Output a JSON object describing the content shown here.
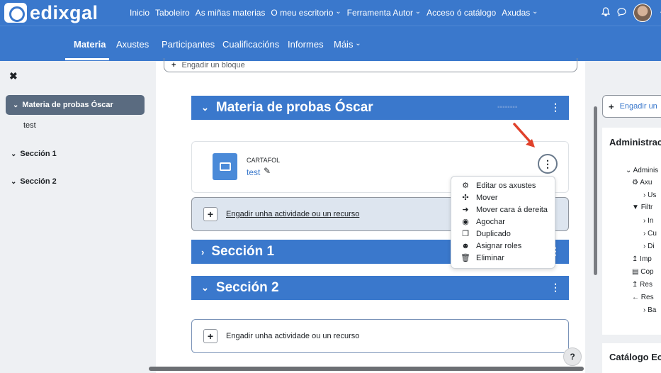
{
  "colors": {
    "brand": "#3a78cc",
    "accent_arrow": "#e0412b",
    "drawer_active": "#5a6b80"
  },
  "brand": {
    "logo_text": "edixgal"
  },
  "topnav": {
    "items": [
      {
        "label": "Inicio",
        "dropdown": false
      },
      {
        "label": "Taboleiro",
        "dropdown": false
      },
      {
        "label": "As miñas materias",
        "dropdown": false
      },
      {
        "label": "O meu escritorio",
        "dropdown": true
      },
      {
        "label": "Ferramenta Autor",
        "dropdown": true
      },
      {
        "label": "Acceso ó catálogo",
        "dropdown": false
      },
      {
        "label": "Axudas",
        "dropdown": true
      }
    ]
  },
  "subnav": {
    "tabs": [
      {
        "label": "Materia",
        "active": true
      },
      {
        "label": "Axustes"
      },
      {
        "label": "Participantes"
      },
      {
        "label": "Cualificacións"
      },
      {
        "label": "Informes"
      },
      {
        "label": "Máis",
        "dropdown": true
      }
    ]
  },
  "drawer": {
    "close_glyph": "✖",
    "items": [
      {
        "label": "Materia de probas Óscar",
        "active": true
      },
      {
        "label": "test",
        "sub": true
      },
      {
        "label": "Sección 1"
      },
      {
        "label": "Sección 2"
      }
    ]
  },
  "main": {
    "add_block_label": "Engadir un bloque",
    "sections": [
      {
        "title": "Materia de probas Óscar",
        "expanded": true
      },
      {
        "title": "Sección 1",
        "expanded": false
      },
      {
        "title": "Sección 2",
        "expanded": true
      }
    ],
    "activity": {
      "type": "CARTAFOL",
      "name": "test"
    },
    "add_activity_label": "Engadir unha actividade ou un recurso"
  },
  "menu": {
    "items": [
      {
        "label": "Editar os axustes",
        "icon": "gear-icon",
        "glyph": "⚙"
      },
      {
        "label": "Mover",
        "icon": "move-icon",
        "glyph": "✣"
      },
      {
        "label": "Mover cara á dereita",
        "icon": "arrow-right-icon",
        "glyph": "➜"
      },
      {
        "label": "Agochar",
        "icon": "eye-icon",
        "glyph": "◉"
      },
      {
        "label": "Duplicado",
        "icon": "copy-icon",
        "glyph": "❐"
      },
      {
        "label": "Asignar roles",
        "icon": "user-circle-icon",
        "glyph": "☻"
      },
      {
        "label": "Eliminar",
        "icon": "trash-icon",
        "glyph": "🗑"
      }
    ]
  },
  "right_panel": {
    "add_block_label": "Engadir un",
    "admin_title": "Administrac",
    "admin_lines": [
      "Adminis",
      "Axu",
      "Us",
      "Filtr",
      "In",
      "Cu",
      "Di",
      "Imp",
      "Cop",
      "Res",
      "Res",
      "Ba"
    ],
    "catalog_title": "Catálogo Ec"
  },
  "help_label": "?"
}
